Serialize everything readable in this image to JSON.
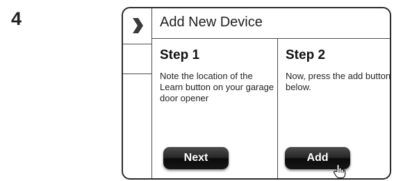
{
  "instruction_number": "4",
  "window": {
    "title": "Add New Device",
    "nav_icon": "chevron-right-icon"
  },
  "steps": [
    {
      "heading": "Step 1",
      "text": "Note the location of the Learn button on your garage door opener",
      "button_label": "Next"
    },
    {
      "heading": "Step 2",
      "text": "Now, press the add button below.",
      "button_label": "Add",
      "cursor_icon": "hand-pointer-icon"
    }
  ],
  "colors": {
    "button_dark": "#161616",
    "frame_border": "#2a2a2a",
    "button_text": "#ffffff"
  }
}
